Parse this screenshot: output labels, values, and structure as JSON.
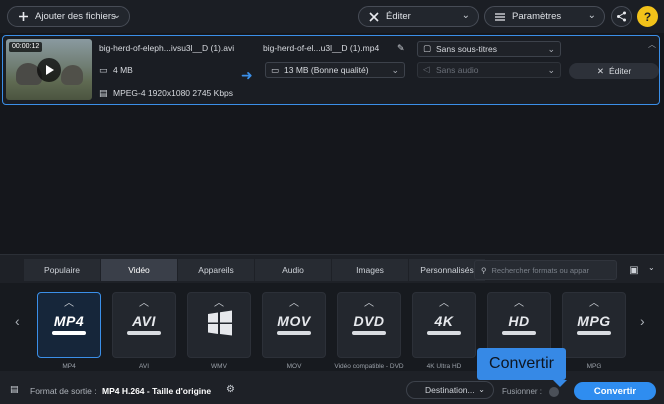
{
  "toolbar": {
    "add_files": "Ajouter des fichiers",
    "edit": "Éditer",
    "settings": "Paramètres"
  },
  "file": {
    "duration": "00:00:12",
    "source_name": "big-herd-of-eleph...ivsu3l__D (1).avi",
    "source_size": "4 MB",
    "source_info": "MPEG-4 1920x1080 2745 Kbps",
    "output_name": "big-herd-of-el...u3l__D (1).mp4",
    "output_size": "13 MB (Bonne qualité)",
    "subtitles": "Sans sous-titres",
    "audio": "Sans audio",
    "edit_button": "Éditer"
  },
  "format_tabs": [
    "Populaire",
    "Vidéo",
    "Appareils",
    "Audio",
    "Images",
    "Personnalisés"
  ],
  "active_tab": "Vidéo",
  "format_search_placeholder": "Rechercher formats ou appar",
  "formats": [
    {
      "logo": "MP4",
      "name": "MP4",
      "icon": "mp4-format-icon"
    },
    {
      "logo": "AVI",
      "name": "AVI",
      "icon": "avi-format-icon"
    },
    {
      "logo": "",
      "name": "WMV",
      "icon": "windows-logo-icon"
    },
    {
      "logo": "MOV",
      "name": "MOV",
      "icon": "mov-format-icon"
    },
    {
      "logo": "DVD",
      "name": "Vidéo compatible - DVD",
      "icon": "dvd-format-icon"
    },
    {
      "logo": "4K",
      "name": "4K Ultra HD",
      "icon": "4k-format-icon"
    },
    {
      "logo": "HD",
      "name": "",
      "icon": "hd-format-icon"
    },
    {
      "logo": "MPG",
      "name": "MPG",
      "icon": "mpg-format-icon"
    }
  ],
  "output": {
    "label": "Format de sortie :",
    "value": "MP4 H.264 - Taille d'origine",
    "destination": "Destination...",
    "merge": "Fusionner :",
    "convert": "Convertir"
  },
  "tooltip": "Convertir",
  "colors": {
    "accent": "#2f8df0",
    "help": "#f2c21a"
  }
}
